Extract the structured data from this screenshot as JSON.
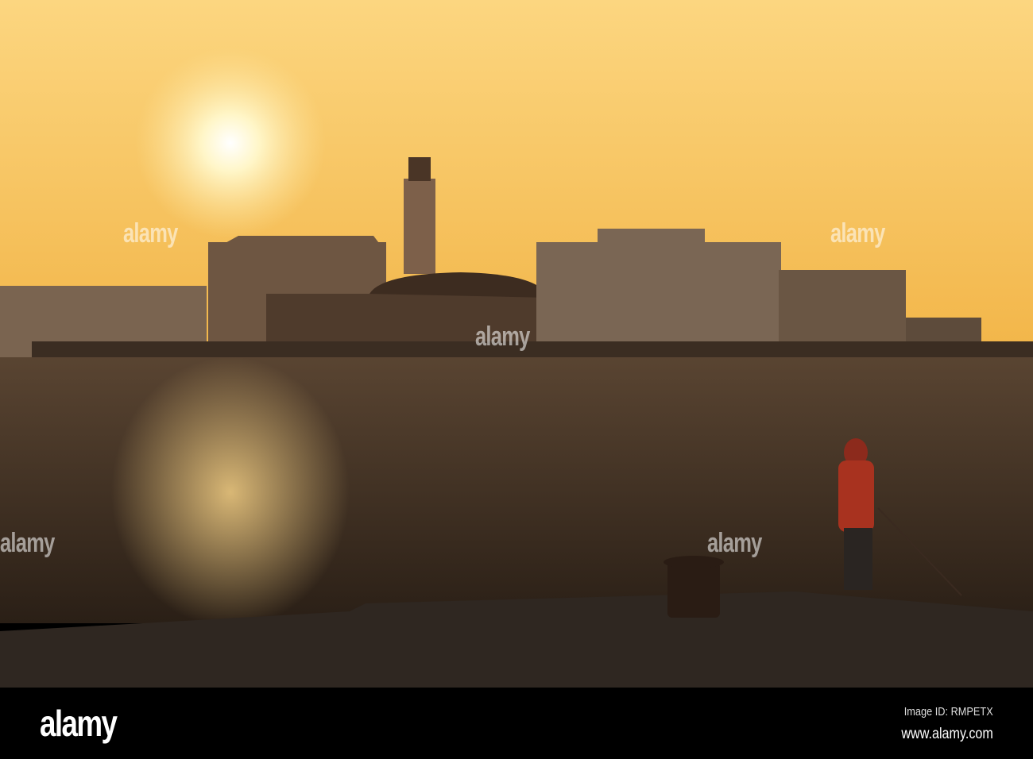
{
  "photo": {
    "subject": "sunset-harbor-lighthouse-fisherman",
    "colors": {
      "sky_top": "#fbd27a",
      "sky_horizon": "#f4b84c",
      "sun": "#fffbe0",
      "water": "#3a2a1c",
      "pier": "#2e2620",
      "buildings": "#6b5440"
    }
  },
  "watermarks": [
    "alamy",
    "alamy",
    "alamy",
    "alamy",
    "alamy",
    "alamy",
    "alamy"
  ],
  "footer": {
    "logo": "alamy",
    "image_id": "Image ID: RMPETX",
    "website": "www.alamy.com"
  }
}
